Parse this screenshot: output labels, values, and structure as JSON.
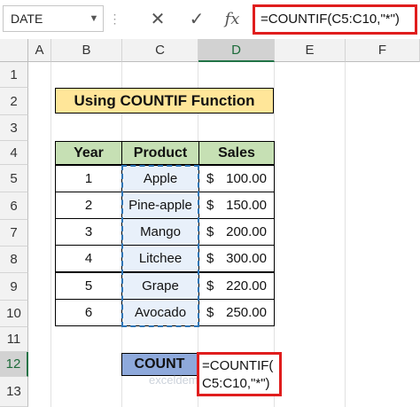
{
  "formula_bar": {
    "name_box": "DATE",
    "cancel_icon": "✕",
    "enter_icon": "✓",
    "fx_label": "fx",
    "formula": "=COUNTIF(C5:C10,\"*\")"
  },
  "columns": [
    "A",
    "B",
    "C",
    "D",
    "E",
    "F"
  ],
  "rows": [
    "1",
    "2",
    "3",
    "4",
    "5",
    "6",
    "7",
    "8",
    "9",
    "10",
    "11",
    "12",
    "13"
  ],
  "sheet": {
    "title": "Using COUNTIF Function",
    "headers": [
      "Year",
      "Product",
      "Sales"
    ],
    "data": [
      {
        "year": "1",
        "product": "Apple",
        "currency": "$",
        "sales": "100.00"
      },
      {
        "year": "2",
        "product": "Pine-apple",
        "currency": "$",
        "sales": "150.00"
      },
      {
        "year": "3",
        "product": "Mango",
        "currency": "$",
        "sales": "200.00"
      },
      {
        "year": "4",
        "product": "Litchee",
        "currency": "$",
        "sales": "300.00"
      },
      {
        "year": "5",
        "product": "Grape",
        "currency": "$",
        "sales": "220.00"
      },
      {
        "year": "6",
        "product": "Avocado",
        "currency": "$",
        "sales": "250.00"
      }
    ],
    "count_label": "COUNT",
    "edit_line1": "=COUNTIF(",
    "edit_line2": "C5:C10,\"*\")"
  },
  "watermark": "exceldemy",
  "colors": {
    "title_fill": "#ffe699",
    "header_fill": "#c6e0b4",
    "count_fill": "#8ea9db",
    "highlight_border": "#e01d1d",
    "range_border": "#2e75b6"
  }
}
